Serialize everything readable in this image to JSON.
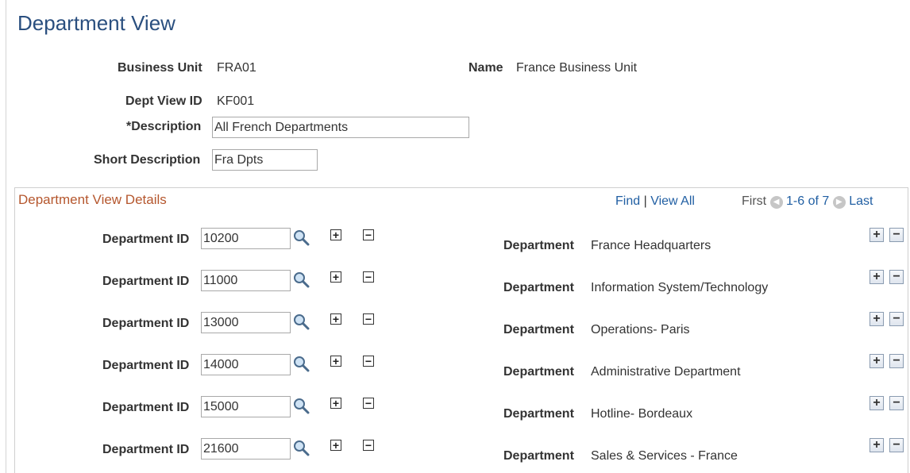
{
  "page": {
    "title": "Department View"
  },
  "header": {
    "business_unit": {
      "label": "Business Unit",
      "value": "FRA01"
    },
    "name": {
      "label": "Name",
      "value": "France Business Unit"
    },
    "dept_view_id": {
      "label": "Dept View ID",
      "value": "KF001"
    },
    "description": {
      "label": "*Description",
      "value": "All French Departments"
    },
    "short_description": {
      "label": "Short Description",
      "value": "Fra Dpts"
    }
  },
  "details": {
    "title": "Department View Details",
    "find_label": "Find",
    "separator": "|",
    "view_all_label": "View All",
    "first_label": "First",
    "range_label": "1-6 of 7",
    "last_label": "Last",
    "dept_id_label": "Department ID",
    "dept_label": "Department",
    "rows": [
      {
        "dept_id": "10200",
        "department": "France Headquarters"
      },
      {
        "dept_id": "11000",
        "department": "Information System/Technology"
      },
      {
        "dept_id": "13000",
        "department": "Operations- Paris"
      },
      {
        "dept_id": "14000",
        "department": "Administrative Department"
      },
      {
        "dept_id": "15000",
        "department": "Hotline- Bordeaux"
      },
      {
        "dept_id": "21600",
        "department": "Sales & Services - France"
      }
    ]
  },
  "icons": {
    "lookup": "magnifier-icon",
    "add": "plus-icon",
    "remove": "minus-icon",
    "prev": "left-arrow-icon",
    "next": "right-arrow-icon"
  },
  "colors": {
    "title": "#2a4f7f",
    "section_title": "#b5572e",
    "link": "#215fa3"
  }
}
